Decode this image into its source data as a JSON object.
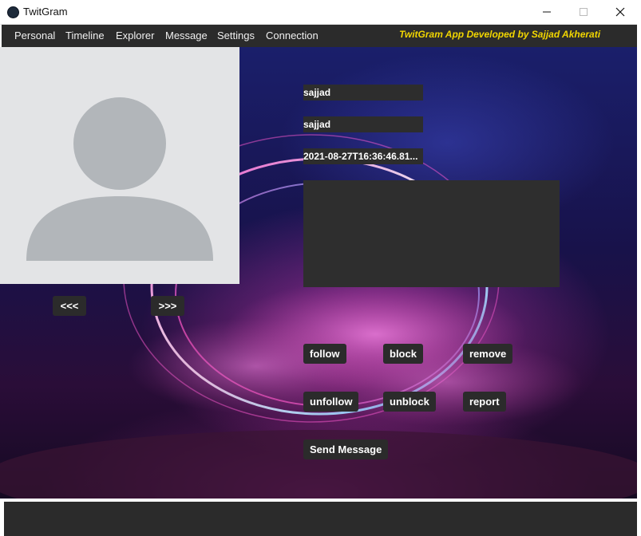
{
  "window": {
    "title": "TwitGram",
    "icon": "app-logo-icon"
  },
  "menu": {
    "items": [
      "Personal",
      "Timeline",
      "Explorer",
      "Message",
      "Settings",
      "Connection"
    ],
    "credit": "TwitGram App Developed by Sajjad Akherati"
  },
  "profile": {
    "avatar_icon": "default-user-icon",
    "username": "sajjad",
    "name": "sajjad",
    "date": "2021-08-27T16:36:46.81...",
    "bio": ""
  },
  "nav": {
    "prev_label": "<<<",
    "next_label": ">>>"
  },
  "actions": {
    "follow": "follow",
    "block": "block",
    "remove": "remove",
    "unfollow": "unfollow",
    "unblock": "unblock",
    "report": "report",
    "send_message": "Send Message"
  },
  "colors": {
    "menu_bg": "#2b2b2b",
    "credit": "#f2d600",
    "avatar_bg": "#e3e4e6"
  }
}
